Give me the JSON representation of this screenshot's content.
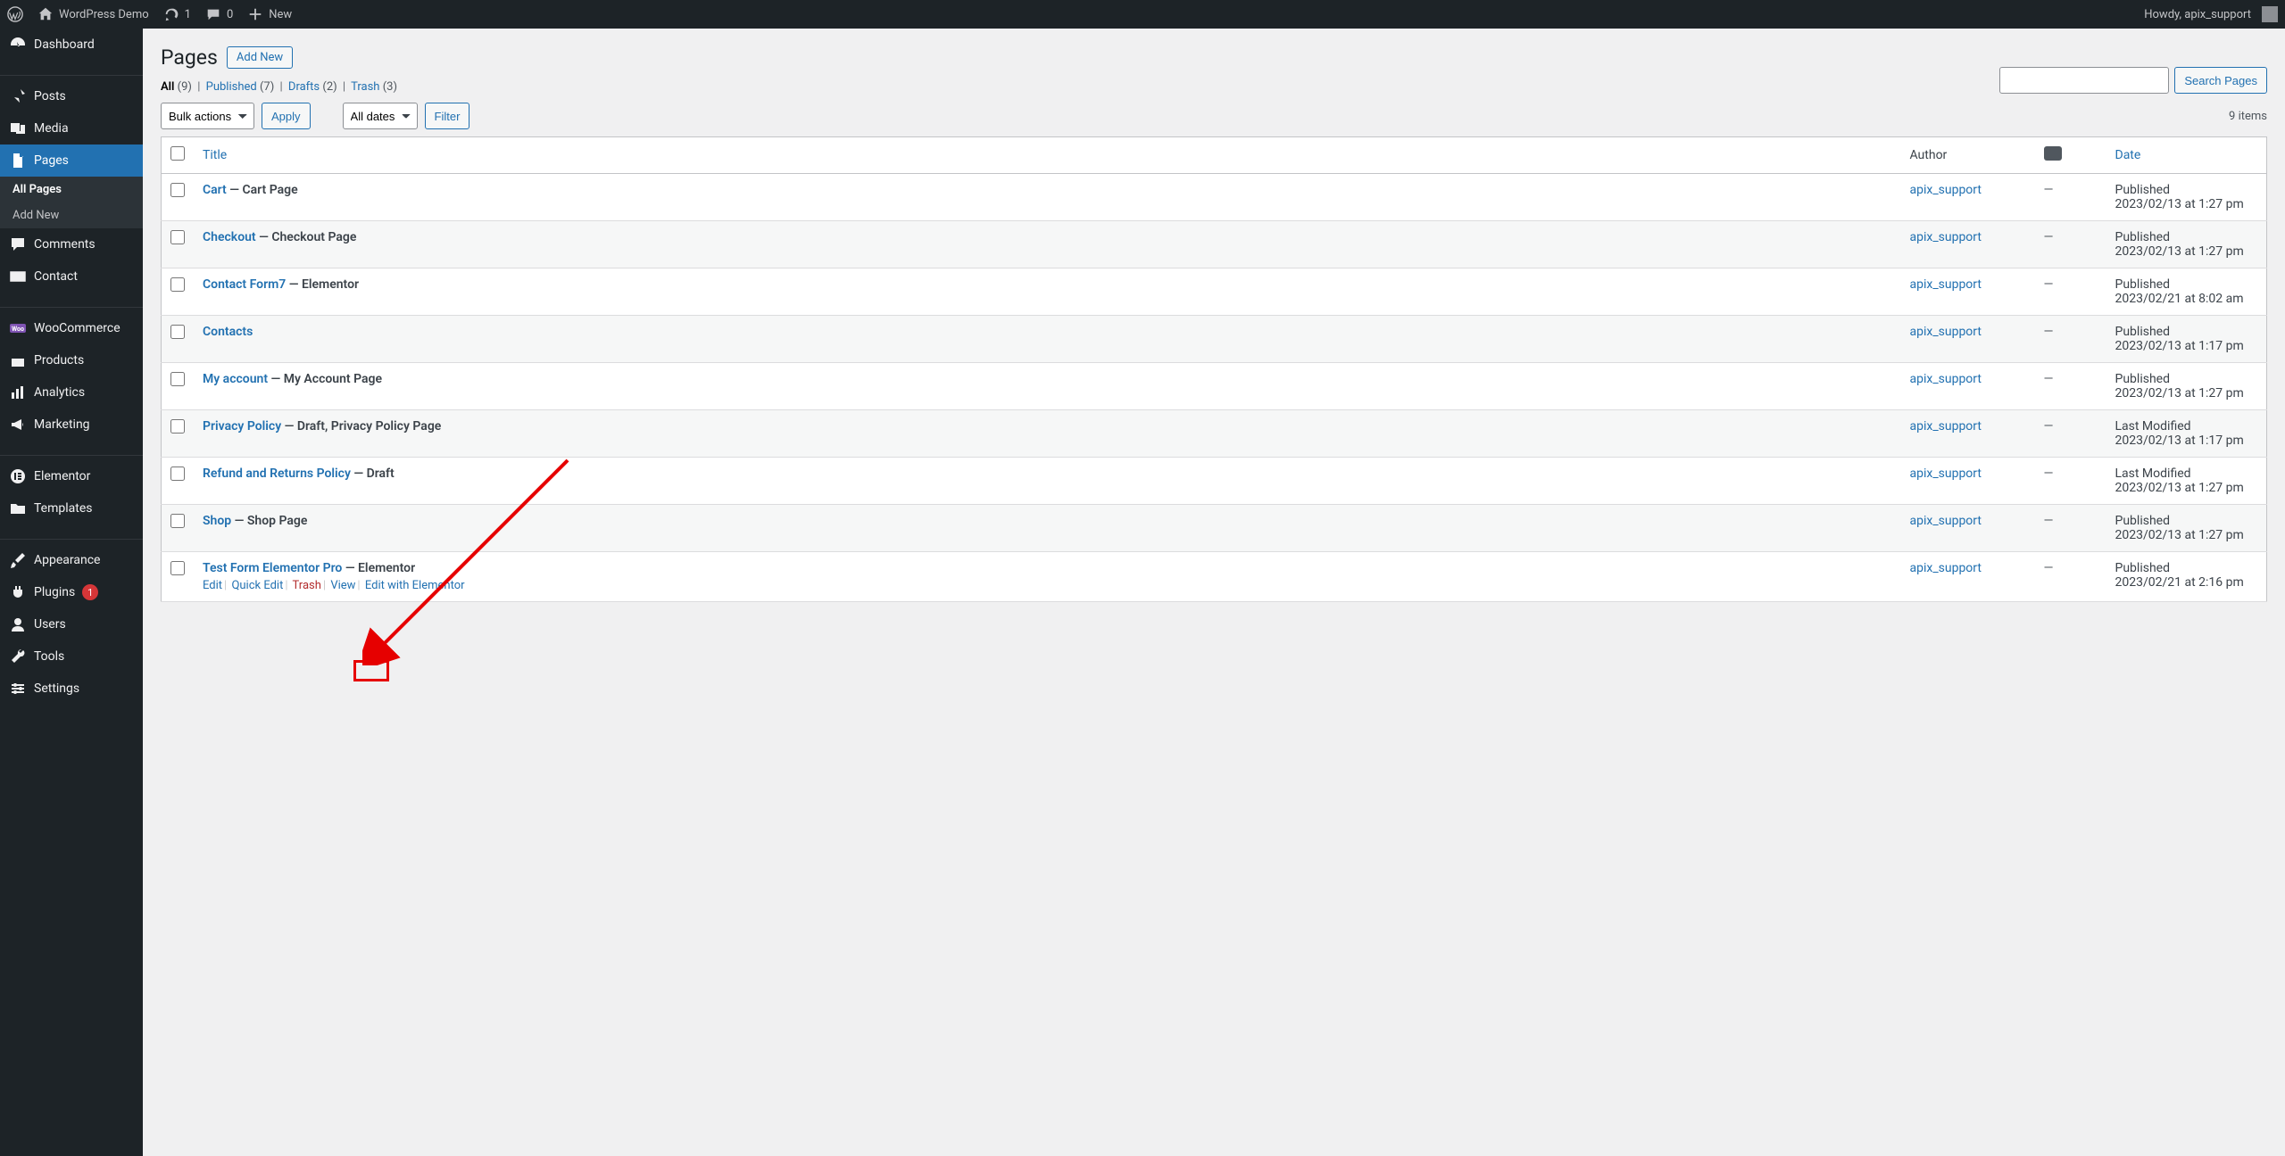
{
  "adminbar": {
    "site_title": "WordPress Demo",
    "updates": "1",
    "comments": "0",
    "new": "New",
    "howdy": "Howdy, apix_support"
  },
  "sidebar": {
    "items": [
      {
        "label": "Dashboard"
      },
      {
        "label": "Posts"
      },
      {
        "label": "Media"
      },
      {
        "label": "Pages"
      },
      {
        "label": "Comments"
      },
      {
        "label": "Contact"
      },
      {
        "label": "WooCommerce"
      },
      {
        "label": "Products"
      },
      {
        "label": "Analytics"
      },
      {
        "label": "Marketing"
      },
      {
        "label": "Elementor"
      },
      {
        "label": "Templates"
      },
      {
        "label": "Appearance"
      },
      {
        "label": "Plugins"
      },
      {
        "label": "Users"
      },
      {
        "label": "Tools"
      },
      {
        "label": "Settings"
      }
    ],
    "plugins_badge": "1",
    "sub": {
      "all": "All Pages",
      "add": "Add New"
    }
  },
  "heading": {
    "title": "Pages",
    "add_new": "Add New"
  },
  "filters": {
    "all": "All",
    "all_count": "(9)",
    "published": "Published",
    "published_count": "(7)",
    "drafts": "Drafts",
    "drafts_count": "(2)",
    "trash": "Trash",
    "trash_count": "(3)"
  },
  "search_button": "Search Pages",
  "bulk": {
    "label": "Bulk actions",
    "apply": "Apply"
  },
  "datefilter": {
    "label": "All dates",
    "filter": "Filter"
  },
  "count_text": "9 items",
  "columns": {
    "title": "Title",
    "author": "Author",
    "date": "Date"
  },
  "rows": [
    {
      "title": "Cart",
      "state": "— Cart Page",
      "author": "apix_support",
      "comments": "—",
      "status": "Published",
      "date": "2023/02/13 at 1:27 pm"
    },
    {
      "title": "Checkout",
      "state": "— Checkout Page",
      "author": "apix_support",
      "comments": "—",
      "status": "Published",
      "date": "2023/02/13 at 1:27 pm"
    },
    {
      "title": "Contact Form7",
      "state": "— Elementor",
      "author": "apix_support",
      "comments": "—",
      "status": "Published",
      "date": "2023/02/21 at 8:02 am"
    },
    {
      "title": "Contacts",
      "state": "",
      "author": "apix_support",
      "comments": "—",
      "status": "Published",
      "date": "2023/02/13 at 1:17 pm"
    },
    {
      "title": "My account",
      "state": "— My Account Page",
      "author": "apix_support",
      "comments": "—",
      "status": "Published",
      "date": "2023/02/13 at 1:27 pm"
    },
    {
      "title": "Privacy Policy",
      "state": "— Draft, Privacy Policy Page",
      "author": "apix_support",
      "comments": "—",
      "status": "Last Modified",
      "date": "2023/02/13 at 1:17 pm"
    },
    {
      "title": "Refund and Returns Policy",
      "state": "— Draft",
      "author": "apix_support",
      "comments": "—",
      "status": "Last Modified",
      "date": "2023/02/13 at 1:27 pm"
    },
    {
      "title": "Shop",
      "state": "— Shop Page",
      "author": "apix_support",
      "comments": "—",
      "status": "Published",
      "date": "2023/02/13 at 1:27 pm"
    },
    {
      "title": "Test Form Elementor Pro",
      "state": "— Elementor",
      "author": "apix_support",
      "comments": "—",
      "status": "Published",
      "date": "2023/02/21 at 2:16 pm"
    }
  ],
  "row_actions": {
    "edit": "Edit",
    "quick": "Quick Edit",
    "trash": "Trash",
    "view": "View",
    "elementor": "Edit with Elementor"
  }
}
